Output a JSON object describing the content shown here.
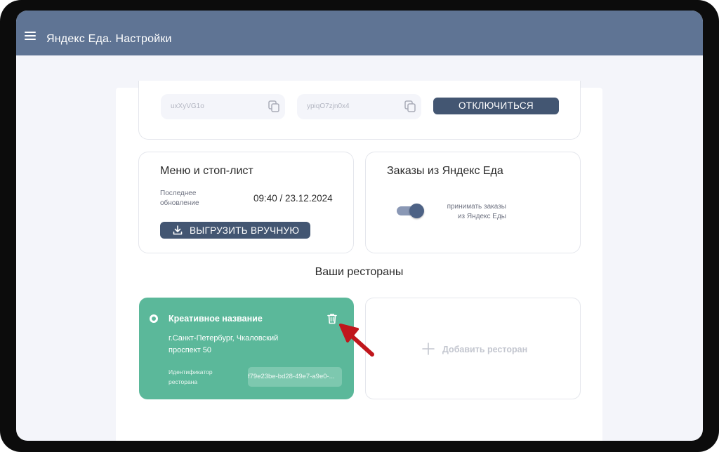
{
  "app": {
    "title": "Яндекс Еда. Настройки"
  },
  "integration": {
    "key1": "uxXyVG1o",
    "key2": "ypiqO7zjn0x4",
    "disconnect_label": "ОТКЛЮЧИТЬСЯ"
  },
  "menu_card": {
    "title": "Меню и стоп-лист",
    "last_update_label": "Последнее обновление",
    "last_update_value": "09:40 / 23.12.2024",
    "upload_label": "ВЫГРУЗИТЬ ВРУЧНУЮ"
  },
  "orders_card": {
    "title": "Заказы из Яндекс Еда",
    "toggle_label": "принимать заказы из Яндекс Еды",
    "toggle_on": true
  },
  "restaurants": {
    "section_title": "Ваши рестораны",
    "items": [
      {
        "name": "Креативное название",
        "address": "г.Санкт-Петербург, Чкаловский проспект 50",
        "id_label": "Идентификатор ресторана",
        "id_value": "f79e23be-bd28-49e7-a9e0-..."
      }
    ],
    "add_label": "Добавить ресторан"
  },
  "colors": {
    "appbar": "#5f7494",
    "primary_button": "#435672",
    "restaurant_card": "#5bb89a",
    "annotation_arrow": "#c0161c"
  },
  "icons": {
    "menu": "menu-icon",
    "copy": "copy-icon",
    "download": "download-icon",
    "trash": "trash-icon",
    "plus": "plus-icon"
  }
}
